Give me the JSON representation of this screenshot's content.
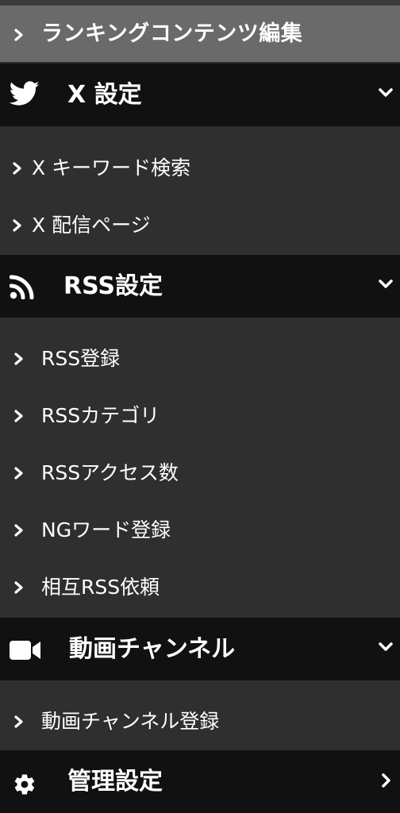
{
  "menu": {
    "active_item": {
      "label": "ランキングコンテンツ編集"
    },
    "sections": [
      {
        "title": "X 設定",
        "icon": "twitter-bird-icon",
        "expanded": true,
        "items": [
          {
            "label": "X キーワード検索"
          },
          {
            "label": "X 配信ページ"
          }
        ]
      },
      {
        "title": "RSS設定",
        "icon": "rss-feed-icon",
        "expanded": true,
        "items": [
          {
            "label": "RSS登録"
          },
          {
            "label": "RSSカテゴリ"
          },
          {
            "label": "RSSアクセス数"
          },
          {
            "label": "NGワード登録"
          },
          {
            "label": "相互RSS依頼"
          }
        ]
      },
      {
        "title": "動画チャンネル",
        "icon": "video-camera-icon",
        "expanded": true,
        "items": [
          {
            "label": "動画チャンネル登録"
          }
        ]
      },
      {
        "title": "管理設定",
        "icon": "gear-icon",
        "expanded": false,
        "items": []
      }
    ]
  },
  "colors": {
    "section_bg": "#111111",
    "item_bg": "#2f2f2f",
    "active_bg": "#6a6a6a",
    "text": "#ffffff"
  }
}
